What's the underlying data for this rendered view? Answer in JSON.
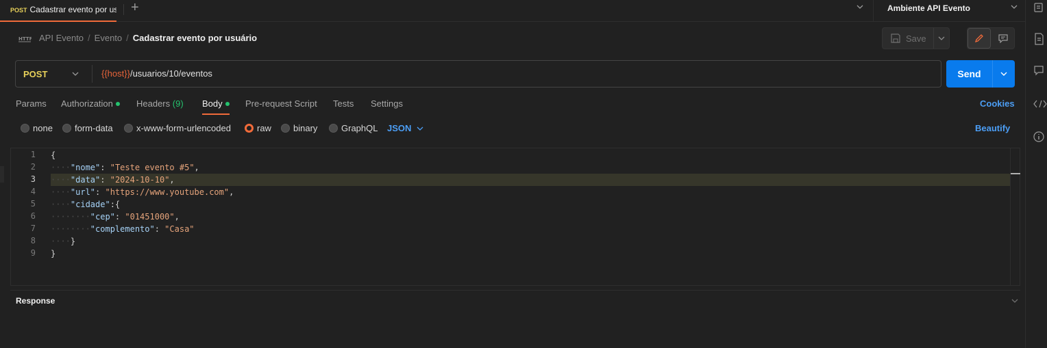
{
  "tab": {
    "method": "POST",
    "title": "Cadastrar evento por us"
  },
  "environment": {
    "label": "Ambiente API Evento"
  },
  "breadcrumb": {
    "root": "API Evento",
    "folder": "Evento",
    "current": "Cadastrar evento por usuário"
  },
  "toolbar": {
    "save_label": "Save"
  },
  "request": {
    "method": "POST",
    "url_var": "{{host}}",
    "url_path": "/usuarios/10/eventos",
    "send_label": "Send"
  },
  "request_tabs": {
    "params": "Params",
    "authorization": "Authorization",
    "headers": "Headers",
    "headers_count": "(9)",
    "body": "Body",
    "prerequest": "Pre-request Script",
    "tests": "Tests",
    "settings": "Settings",
    "cookies": "Cookies"
  },
  "body_types": {
    "none": "none",
    "form_data": "form-data",
    "urlencoded": "x-www-form-urlencoded",
    "raw": "raw",
    "binary": "binary",
    "graphql": "GraphQL",
    "format": "JSON",
    "beautify": "Beautify"
  },
  "editor": {
    "line_numbers": [
      "1",
      "2",
      "3",
      "4",
      "5",
      "6",
      "7",
      "8",
      "9"
    ],
    "current_line": 3
  },
  "json_body": {
    "nome_key": "\"nome\"",
    "nome_val": "\"Teste evento #5\"",
    "data_key": "\"data\"",
    "data_val": "\"2024-10-10\"",
    "url_key": "\"url\"",
    "url_val": "\"https://www.youtube.com\"",
    "cidade_key": "\"cidade\"",
    "cep_key": "\"cep\"",
    "cep_val": "\"01451000\"",
    "complemento_key": "\"complemento\"",
    "complemento_val": "\"Casa\""
  },
  "response": {
    "label": "Response"
  },
  "colors": {
    "accent": "#f26b3a",
    "send": "#097bed",
    "method": "#e8d15a",
    "link": "#4c9ef5",
    "dot": "#25c26e"
  }
}
